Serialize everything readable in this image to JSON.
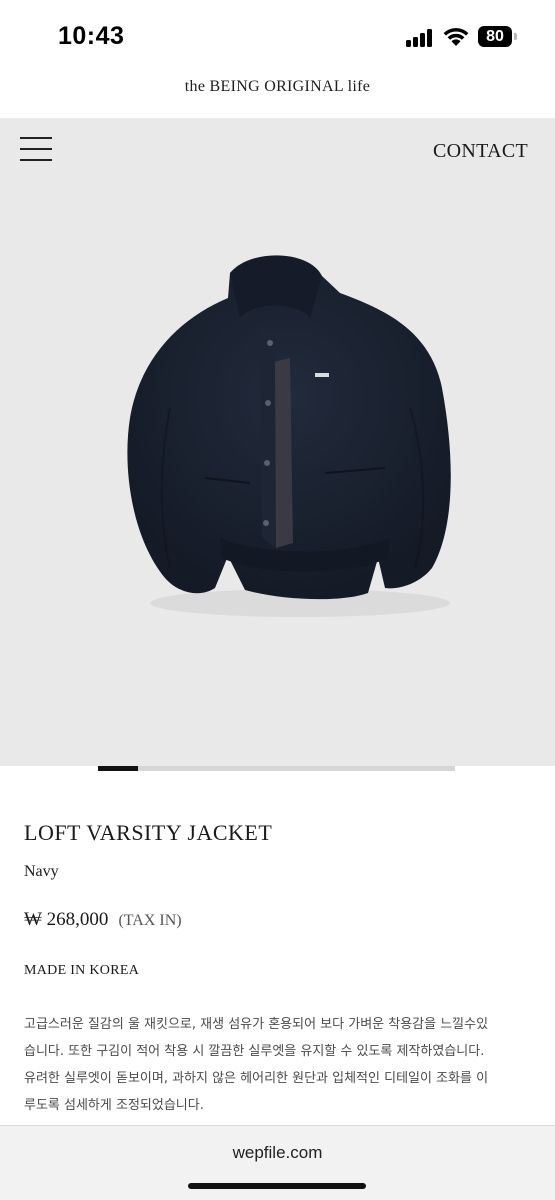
{
  "status_bar": {
    "time": "10:43",
    "battery_level": "80"
  },
  "brand": {
    "name": "the BEING ORIGINAL life"
  },
  "header": {
    "menu_icon": "hamburger-menu-icon",
    "contact_label": "CONTACT"
  },
  "carousel": {
    "current_slide": 1
  },
  "product": {
    "image_subject": "navy wool varsity jacket",
    "title": "LOFT VARSITY JACKET",
    "color": "Navy",
    "price": "₩ 268,000",
    "tax_note": "(TAX IN)",
    "origin": "MADE IN KOREA",
    "description_lines": [
      "고급스러운 질감의 울 재킷으로, 재생 섬유가 혼용되어 보다 가벼운 착용감을 느낄수있",
      "습니다. 또한 구김이 적어 착용 시 깔끔한 실루엣을 유지할 수 있도록 제작하였습니다.",
      "유려한 실루엣이 돋보이며, 과하지 않은 헤어리한 원단과 입체적인 디테일이 조화를 이",
      "루도록 섬세하게 조정되었습니다."
    ]
  },
  "browser": {
    "url": "wepfile.com"
  },
  "colors": {
    "hero_background": "#e9e9e9",
    "jacket_navy": "#1b2333",
    "indicator_active": "#111111",
    "indicator_track": "#d6d6d6"
  }
}
